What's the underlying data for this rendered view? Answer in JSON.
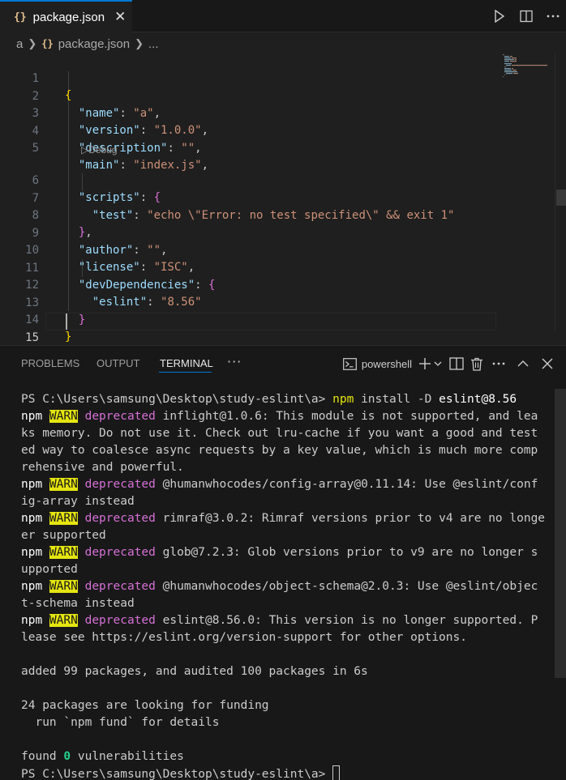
{
  "tab": {
    "icon": "{}",
    "title": "package.json",
    "close": "✕"
  },
  "breadcrumb": {
    "folder": "a",
    "icon": "{}",
    "file": "package.json",
    "more": "..."
  },
  "editor": {
    "line_numbers": [
      "1",
      "2",
      "3",
      "4",
      "5",
      "6",
      "7",
      "8",
      "9",
      "10",
      "11",
      "12",
      "13",
      "14",
      "15"
    ],
    "codelens": "Debug",
    "json": {
      "name": "\"a\"",
      "version": "\"1.0.0\"",
      "description": "\"\"",
      "main": "\"index.js\"",
      "test": "\"echo \\\"Error: no test specified\\\" && exit 1\"",
      "author": "\"\"",
      "license": "\"ISC\"",
      "eslint": "\"8.56\""
    },
    "keys": {
      "name": "\"name\"",
      "version": "\"version\"",
      "description": "\"description\"",
      "main": "\"main\"",
      "scripts": "\"scripts\"",
      "test": "\"test\"",
      "author": "\"author\"",
      "license": "\"license\"",
      "devDependencies": "\"devDependencies\"",
      "eslint": "\"eslint\""
    }
  },
  "panel": {
    "tabs": [
      "PROBLEMS",
      "OUTPUT",
      "TERMINAL"
    ],
    "active_tab": "TERMINAL",
    "more": "···",
    "shell": "powershell"
  },
  "terminal": {
    "prompt": "PS C:\\Users\\samsung\\Desktop\\study-eslint\\a>",
    "command": "npm",
    "command_args": "install -D",
    "command_pkg": "eslint@8.56",
    "npm": "npm",
    "warn": "WARN",
    "deprecated": "deprecated",
    "lines": [
      [
        " inflight@1.0.6: This module is not supported, and lea",
        "ks memory. Do not use it. Check out lru-cache if you want a good and test",
        "ed way to coalesce async requests by a key value, which is much more comp",
        "rehensive and powerful."
      ],
      [
        " @humanwhocodes/config-array@0.11.14: Use @eslint/conf",
        "ig-array instead"
      ],
      [
        " rimraf@3.0.2: Rimraf versions prior to v4 are no longe",
        "er supported"
      ],
      [
        " glob@7.2.3: Glob versions prior to v9 are no longer s",
        "upported"
      ],
      [
        " @humanwhocodes/object-schema@2.0.3: Use @eslint/objec",
        "t-schema instead"
      ],
      [
        " eslint@8.56.0: This version is no longer supported. P",
        "lease see https://eslint.org/version-support for other options."
      ]
    ],
    "added": "added 99 packages, and audited 100 packages in 6s",
    "funding1": "24 packages are looking for funding",
    "funding2": "  run `npm fund` for details",
    "found_pre": "found ",
    "found_count": "0",
    "found_post": " vulnerabilities"
  }
}
